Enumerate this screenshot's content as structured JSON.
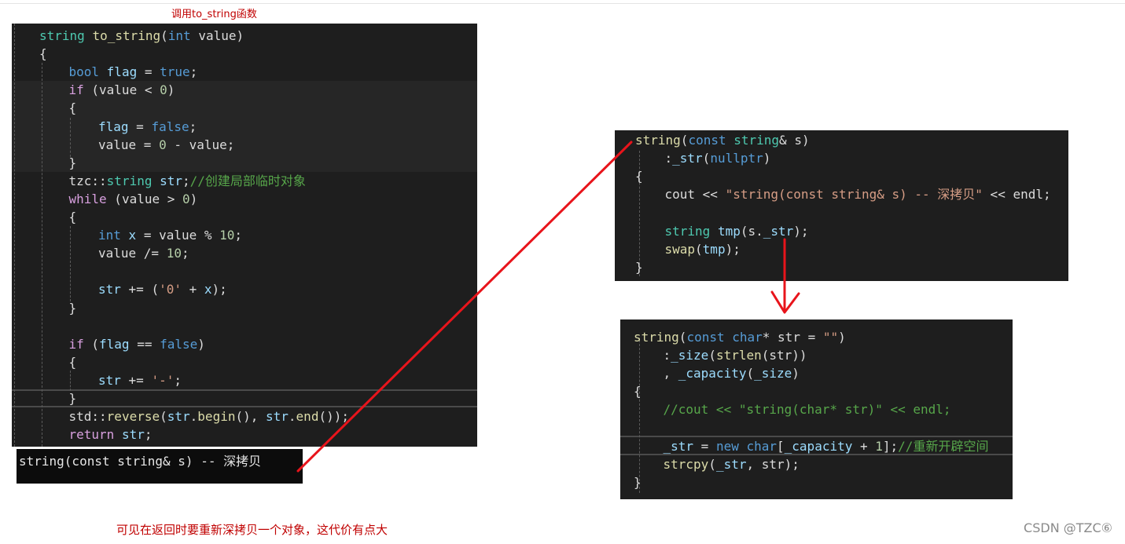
{
  "captions": {
    "top": "调用to_string函数",
    "bottom": "可见在返回时要重新深拷贝一个对象，这代价有点大",
    "watermark": "CSDN @TZC⑥"
  },
  "panel_left": {
    "lines": [
      {
        "indent": 0,
        "tokens": [
          {
            "c": "ty",
            "t": "string"
          },
          {
            "c": "pl",
            "t": " "
          },
          {
            "c": "fn",
            "t": "to_string"
          },
          {
            "c": "pl",
            "t": "("
          },
          {
            "c": "kw",
            "t": "int"
          },
          {
            "c": "pl",
            "t": " value)"
          }
        ]
      },
      {
        "indent": 0,
        "tokens": [
          {
            "c": "pl",
            "t": "{"
          }
        ]
      },
      {
        "indent": 1,
        "tokens": [
          {
            "c": "kw",
            "t": "bool"
          },
          {
            "c": "pl",
            "t": " "
          },
          {
            "c": "var",
            "t": "flag"
          },
          {
            "c": "pl",
            "t": " = "
          },
          {
            "c": "kw",
            "t": "true"
          },
          {
            "c": "pl",
            "t": ";"
          }
        ]
      },
      {
        "indent": 1,
        "tokens": [
          {
            "c": "ctl",
            "t": "if"
          },
          {
            "c": "pl",
            "t": " (value < "
          },
          {
            "c": "num",
            "t": "0"
          },
          {
            "c": "pl",
            "t": ")"
          }
        ]
      },
      {
        "indent": 1,
        "tokens": [
          {
            "c": "pl",
            "t": "{"
          }
        ]
      },
      {
        "indent": 2,
        "tokens": [
          {
            "c": "var",
            "t": "flag"
          },
          {
            "c": "pl",
            "t": " = "
          },
          {
            "c": "kw",
            "t": "false"
          },
          {
            "c": "pl",
            "t": ";"
          }
        ]
      },
      {
        "indent": 2,
        "tokens": [
          {
            "c": "pl",
            "t": "value = "
          },
          {
            "c": "num",
            "t": "0"
          },
          {
            "c": "pl",
            "t": " - value;"
          }
        ]
      },
      {
        "indent": 1,
        "tokens": [
          {
            "c": "pl",
            "t": "}"
          }
        ]
      },
      {
        "indent": 1,
        "tokens": [
          {
            "c": "pl",
            "t": "tzc::"
          },
          {
            "c": "ty",
            "t": "string"
          },
          {
            "c": "pl",
            "t": " "
          },
          {
            "c": "var",
            "t": "str"
          },
          {
            "c": "pl",
            "t": ";"
          },
          {
            "c": "cmt",
            "t": "//创建局部临时对象"
          }
        ]
      },
      {
        "indent": 1,
        "tokens": [
          {
            "c": "ctl",
            "t": "while"
          },
          {
            "c": "pl",
            "t": " (value > "
          },
          {
            "c": "num",
            "t": "0"
          },
          {
            "c": "pl",
            "t": ")"
          }
        ]
      },
      {
        "indent": 1,
        "tokens": [
          {
            "c": "pl",
            "t": "{"
          }
        ]
      },
      {
        "indent": 2,
        "tokens": [
          {
            "c": "kw",
            "t": "int"
          },
          {
            "c": "pl",
            "t": " "
          },
          {
            "c": "var",
            "t": "x"
          },
          {
            "c": "pl",
            "t": " = value % "
          },
          {
            "c": "num",
            "t": "10"
          },
          {
            "c": "pl",
            "t": ";"
          }
        ]
      },
      {
        "indent": 2,
        "tokens": [
          {
            "c": "pl",
            "t": "value /= "
          },
          {
            "c": "num",
            "t": "10"
          },
          {
            "c": "pl",
            "t": ";"
          }
        ]
      },
      {
        "indent": 2,
        "tokens": []
      },
      {
        "indent": 2,
        "tokens": [
          {
            "c": "var",
            "t": "str"
          },
          {
            "c": "pl",
            "t": " += ("
          },
          {
            "c": "strl",
            "t": "'0'"
          },
          {
            "c": "pl",
            "t": " + "
          },
          {
            "c": "var",
            "t": "x"
          },
          {
            "c": "pl",
            "t": ");"
          }
        ]
      },
      {
        "indent": 1,
        "tokens": [
          {
            "c": "pl",
            "t": "}"
          }
        ]
      },
      {
        "indent": 1,
        "tokens": []
      },
      {
        "indent": 1,
        "tokens": [
          {
            "c": "ctl",
            "t": "if"
          },
          {
            "c": "pl",
            "t": " ("
          },
          {
            "c": "var",
            "t": "flag"
          },
          {
            "c": "pl",
            "t": " == "
          },
          {
            "c": "kw",
            "t": "false"
          },
          {
            "c": "pl",
            "t": ")"
          }
        ]
      },
      {
        "indent": 1,
        "tokens": [
          {
            "c": "pl",
            "t": "{"
          }
        ]
      },
      {
        "indent": 2,
        "tokens": [
          {
            "c": "var",
            "t": "str"
          },
          {
            "c": "pl",
            "t": " += "
          },
          {
            "c": "strl",
            "t": "'-'"
          },
          {
            "c": "pl",
            "t": ";"
          }
        ]
      },
      {
        "indent": 1,
        "tokens": [
          {
            "c": "pl",
            "t": "}"
          }
        ]
      },
      {
        "indent": 1,
        "tokens": [
          {
            "c": "pl",
            "t": "std::"
          },
          {
            "c": "fn",
            "t": "reverse"
          },
          {
            "c": "pl",
            "t": "("
          },
          {
            "c": "var",
            "t": "str"
          },
          {
            "c": "pl",
            "t": "."
          },
          {
            "c": "fn",
            "t": "begin"
          },
          {
            "c": "pl",
            "t": "(), "
          },
          {
            "c": "var",
            "t": "str"
          },
          {
            "c": "pl",
            "t": "."
          },
          {
            "c": "fn",
            "t": "end"
          },
          {
            "c": "pl",
            "t": "());"
          }
        ]
      },
      {
        "indent": 1,
        "tokens": [
          {
            "c": "ctl",
            "t": "return"
          },
          {
            "c": "pl",
            "t": " "
          },
          {
            "c": "var",
            "t": "str"
          },
          {
            "c": "pl",
            "t": ";"
          }
        ]
      }
    ]
  },
  "console": {
    "output": "string(const string& s) -- 深拷贝"
  },
  "panel_copy": {
    "lines": [
      {
        "indent": 0,
        "tokens": [
          {
            "c": "fn",
            "t": "string"
          },
          {
            "c": "pl",
            "t": "("
          },
          {
            "c": "kw",
            "t": "const"
          },
          {
            "c": "pl",
            "t": " "
          },
          {
            "c": "ty",
            "t": "string"
          },
          {
            "c": "pl",
            "t": "& s)"
          }
        ]
      },
      {
        "indent": 1,
        "tokens": [
          {
            "c": "pl",
            "t": ":"
          },
          {
            "c": "var",
            "t": "_str"
          },
          {
            "c": "pl",
            "t": "("
          },
          {
            "c": "kw",
            "t": "nullptr"
          },
          {
            "c": "pl",
            "t": ")"
          }
        ]
      },
      {
        "indent": 0,
        "tokens": [
          {
            "c": "pl",
            "t": "{"
          }
        ]
      },
      {
        "indent": 1,
        "tokens": [
          {
            "c": "pl",
            "t": "cout << "
          },
          {
            "c": "strl",
            "t": "\"string(const string& s) -- 深拷贝\""
          },
          {
            "c": "pl",
            "t": " << endl;"
          }
        ]
      },
      {
        "indent": 1,
        "tokens": []
      },
      {
        "indent": 1,
        "tokens": [
          {
            "c": "ty",
            "t": "string"
          },
          {
            "c": "pl",
            "t": " "
          },
          {
            "c": "var",
            "t": "tmp"
          },
          {
            "c": "pl",
            "t": "(s."
          },
          {
            "c": "var",
            "t": "_str"
          },
          {
            "c": "pl",
            "t": ");"
          }
        ]
      },
      {
        "indent": 1,
        "tokens": [
          {
            "c": "fn",
            "t": "swap"
          },
          {
            "c": "pl",
            "t": "("
          },
          {
            "c": "var",
            "t": "tmp"
          },
          {
            "c": "pl",
            "t": ");"
          }
        ]
      },
      {
        "indent": 0,
        "tokens": [
          {
            "c": "pl",
            "t": "}"
          }
        ]
      }
    ]
  },
  "panel_ctor": {
    "lines": [
      {
        "indent": 0,
        "tokens": [
          {
            "c": "fn",
            "t": "string"
          },
          {
            "c": "pl",
            "t": "("
          },
          {
            "c": "kw",
            "t": "const"
          },
          {
            "c": "pl",
            "t": " "
          },
          {
            "c": "kw",
            "t": "char"
          },
          {
            "c": "pl",
            "t": "* str = "
          },
          {
            "c": "strl",
            "t": "\"\""
          },
          {
            "c": "pl",
            "t": ")"
          }
        ]
      },
      {
        "indent": 1,
        "tokens": [
          {
            "c": "pl",
            "t": ":"
          },
          {
            "c": "var",
            "t": "_size"
          },
          {
            "c": "pl",
            "t": "("
          },
          {
            "c": "fn",
            "t": "strlen"
          },
          {
            "c": "pl",
            "t": "(str))"
          }
        ]
      },
      {
        "indent": 1,
        "tokens": [
          {
            "c": "pl",
            "t": ", "
          },
          {
            "c": "var",
            "t": "_capacity"
          },
          {
            "c": "pl",
            "t": "("
          },
          {
            "c": "var",
            "t": "_size"
          },
          {
            "c": "pl",
            "t": ")"
          }
        ]
      },
      {
        "indent": 0,
        "tokens": [
          {
            "c": "pl",
            "t": "{"
          }
        ]
      },
      {
        "indent": 1,
        "tokens": [
          {
            "c": "cmt",
            "t": "//cout << \"string(char* str)\" << endl;"
          }
        ]
      },
      {
        "indent": 1,
        "tokens": []
      },
      {
        "indent": 1,
        "tokens": [
          {
            "c": "var",
            "t": "_str"
          },
          {
            "c": "pl",
            "t": " = "
          },
          {
            "c": "kw",
            "t": "new"
          },
          {
            "c": "pl",
            "t": " "
          },
          {
            "c": "kw",
            "t": "char"
          },
          {
            "c": "pl",
            "t": "["
          },
          {
            "c": "var",
            "t": "_capacity"
          },
          {
            "c": "pl",
            "t": " + "
          },
          {
            "c": "num",
            "t": "1"
          },
          {
            "c": "pl",
            "t": "];"
          },
          {
            "c": "cmt",
            "t": "//重新开辟空间"
          }
        ]
      },
      {
        "indent": 1,
        "tokens": [
          {
            "c": "fn",
            "t": "strcpy"
          },
          {
            "c": "pl",
            "t": "("
          },
          {
            "c": "var",
            "t": "_str"
          },
          {
            "c": "pl",
            "t": ", str);"
          }
        ]
      },
      {
        "indent": 0,
        "tokens": [
          {
            "c": "pl",
            "t": "}"
          }
        ]
      }
    ]
  },
  "colors": {
    "annotation_red": "#e8141b",
    "editor_bg": "#1e1e1e",
    "caption_red": "#c00000"
  }
}
